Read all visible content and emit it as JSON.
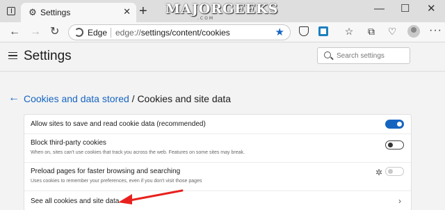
{
  "browser": {
    "tab": {
      "title": "Settings",
      "icon": "gear-icon"
    },
    "new_tab_symbol": "+",
    "window_controls": {
      "minimize": "—",
      "maximize": "☐",
      "close": "✕"
    },
    "tab_close_symbol": "✕",
    "watermark": {
      "text": "MAJORGEEKS",
      "sub": ".COM"
    },
    "address": {
      "site_label": "Edge",
      "url_prefix": "edge://",
      "url_path": "settings/content/cookies"
    },
    "nav": {
      "back": "←",
      "forward": "→",
      "refresh": "↻"
    },
    "favorite_symbol": "★",
    "more_symbol": "···"
  },
  "settings": {
    "title": "Settings",
    "search": {
      "placeholder": "Search settings"
    }
  },
  "breadcrumb": {
    "back_symbol": "←",
    "parent": "Cookies and data stored",
    "separator": " / ",
    "current": "Cookies and site data"
  },
  "options": [
    {
      "label": "Allow sites to save and read cookie data (recommended)",
      "description": "",
      "toggle": "on"
    },
    {
      "label": "Block third-party cookies",
      "description": "When on, sites can't use cookies that track you across the web. Features on some sites may break.",
      "toggle": "off"
    },
    {
      "label": "Preload pages for faster browsing and searching",
      "description": "Uses cookies to remember your preferences, even if you don't visit those pages",
      "toggle": "disabled"
    },
    {
      "label": "See all cookies and site data",
      "description": "",
      "toggle": "none"
    }
  ],
  "colors": {
    "accent": "#1565c0",
    "annotation_arrow": "#e8211e"
  }
}
